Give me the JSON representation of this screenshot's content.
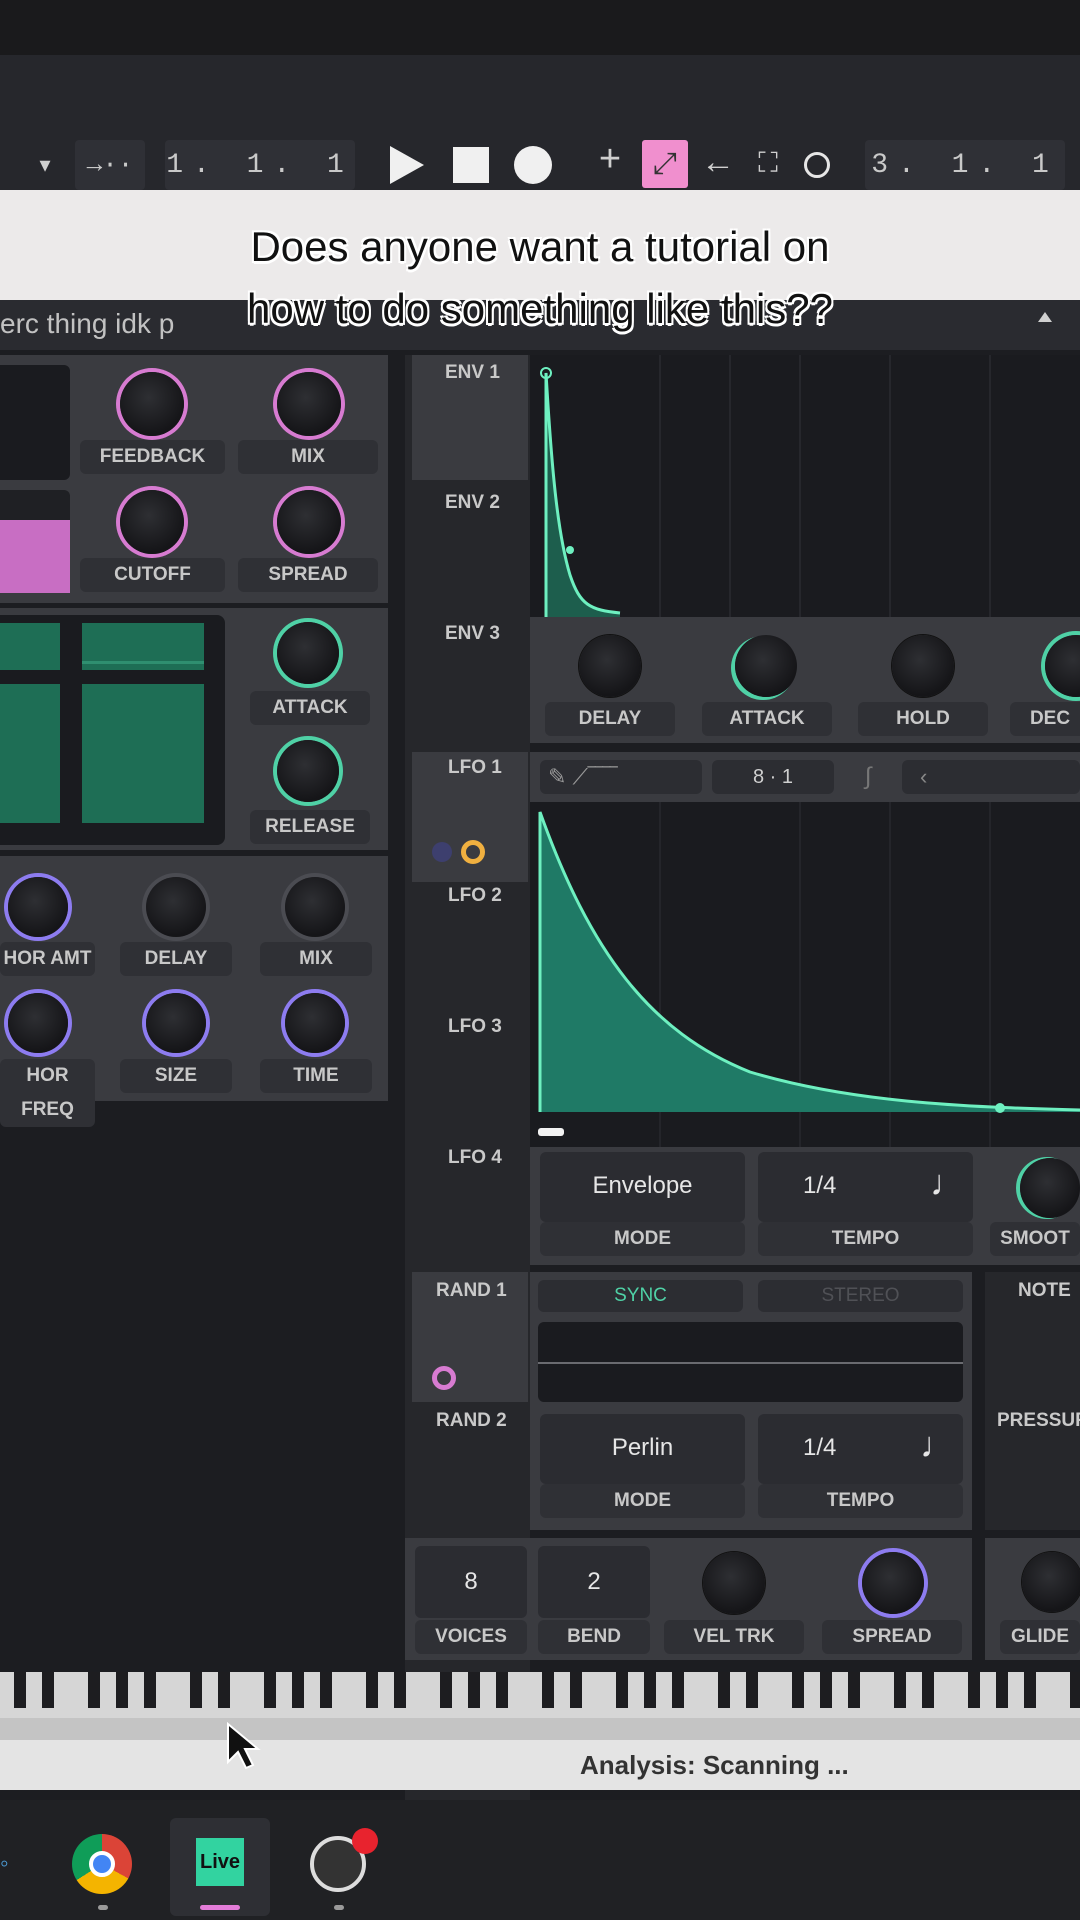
{
  "transport": {
    "position": "1. 1. 1",
    "position2": "3. 1. 1",
    "icons": [
      "dropdown-arrow-icon",
      "follow-icon",
      "play-icon",
      "stop-icon",
      "record-icon",
      "add-icon",
      "draw-mode-icon",
      "back-arrow-icon",
      "fullscreen-icon",
      "loop-icon"
    ]
  },
  "caption": {
    "line1": "Does anyone want a tutorial on",
    "line2": "how to do something like this??"
  },
  "preset": {
    "name": "erc thing idk p"
  },
  "effects": {
    "feedback": "FEEDBACK",
    "mix": "MIX",
    "cutoff": "CUTOFF",
    "spread": "SPREAD",
    "attack": "ATTACK",
    "release": "RELEASE",
    "chor_amt": "HOR AMT",
    "delay": "DELAY",
    "mix2": "MIX",
    "chor_freq": "HOR FREQ",
    "size": "SIZE",
    "time": "TIME"
  },
  "sources": {
    "env1": "ENV 1",
    "env2": "ENV 2",
    "env3": "ENV 3",
    "lfo1": "LFO 1",
    "lfo2": "LFO 2",
    "lfo3": "LFO 3",
    "lfo4": "LFO 4",
    "rand1": "RAND 1",
    "rand2": "RAND 2"
  },
  "env": {
    "delay": "DELAY",
    "attack": "ATTACK",
    "hold": "HOLD",
    "decay": "DEC"
  },
  "lfo": {
    "grid": "8 · 1",
    "mode_value": "Envelope",
    "mode_label": "MODE",
    "tempo_value": "1/4",
    "tempo_label": "TEMPO",
    "smooth_label": "SMOOT"
  },
  "rand": {
    "sync": "SYNC",
    "stereo": "STEREO",
    "mode_value": "Perlin",
    "mode_label": "MODE",
    "tempo_value": "1/4",
    "tempo_label": "TEMPO",
    "note": "NOTE",
    "pressure": "PRESSUR"
  },
  "voice": {
    "voices_value": "8",
    "voices_label": "VOICES",
    "bend_value": "2",
    "bend_label": "BEND",
    "vel_trk": "VEL TRK",
    "spread": "SPREAD",
    "glide": "GLIDE"
  },
  "status": {
    "analysis": "Analysis: Scanning ..."
  },
  "taskbar": {
    "apps": [
      "chrome-icon",
      "live-icon",
      "obs-icon"
    ],
    "live_label": "Live"
  },
  "colors": {
    "accent_green": "#4fd1a6",
    "accent_pink": "#d77bd1",
    "accent_purple": "#8d7cf0",
    "wave_fill": "#1f7a66"
  }
}
